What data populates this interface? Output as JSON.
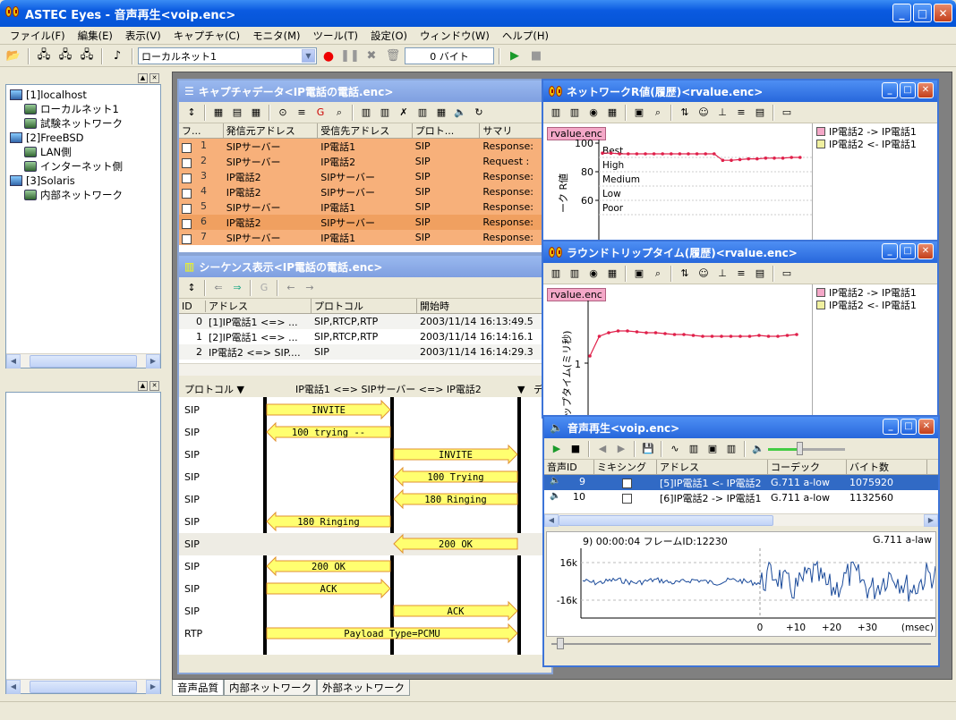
{
  "title": "ASTEC Eyes - 音声再生<voip.enc>",
  "menu": [
    "ファイル(F)",
    "編集(E)",
    "表示(V)",
    "キャプチャ(C)",
    "モニタ(M)",
    "ツール(T)",
    "設定(O)",
    "ウィンドウ(W)",
    "ヘルプ(H)"
  ],
  "toolbar": {
    "network_select": "ローカルネット1",
    "bytes": "0 バイト"
  },
  "tree": [
    {
      "label": "[1]localhost",
      "level": 0,
      "icon": "computer-icon"
    },
    {
      "label": "ローカルネット1",
      "level": 1,
      "icon": "network-icon"
    },
    {
      "label": "試験ネットワーク",
      "level": 1,
      "icon": "network-icon"
    },
    {
      "label": "[2]FreeBSD",
      "level": 0,
      "icon": "computer-icon"
    },
    {
      "label": "LAN側",
      "level": 1,
      "icon": "network-icon"
    },
    {
      "label": "インターネット側",
      "level": 1,
      "icon": "network-icon"
    },
    {
      "label": "[3]Solaris",
      "level": 0,
      "icon": "computer-icon"
    },
    {
      "label": "内部ネットワーク",
      "level": 1,
      "icon": "network-icon"
    }
  ],
  "capture": {
    "title": "キャプチャデータ<IP電話の電話.enc>",
    "columns": [
      "フ...",
      "発信元アドレス",
      "受信先アドレス",
      "プロト...",
      "サマリ"
    ],
    "rows": [
      [
        "1",
        "SIPサーバー",
        "IP電話1",
        "SIP",
        "Response:"
      ],
      [
        "2",
        "SIPサーバー",
        "IP電話2",
        "SIP",
        "Request :"
      ],
      [
        "3",
        "IP電話2",
        "SIPサーバー",
        "SIP",
        "Response:"
      ],
      [
        "4",
        "IP電話2",
        "SIPサーバー",
        "SIP",
        "Response:"
      ],
      [
        "5",
        "SIPサーバー",
        "IP電話1",
        "SIP",
        "Response:"
      ],
      [
        "6",
        "IP電話2",
        "SIPサーバー",
        "SIP",
        "Response:"
      ],
      [
        "7",
        "SIPサーバー",
        "IP電話1",
        "SIP",
        "Response:"
      ]
    ],
    "selected_row": 5
  },
  "sequence": {
    "title": "シーケンス表示<IP電話の電話.enc>",
    "columns": [
      "ID",
      "アドレス",
      "プロトコル",
      "開始時"
    ],
    "rows": [
      [
        "0",
        "[1]IP電話1 <=> ...",
        "SIP,RTCP,RTP",
        "2003/11/14  16:13:49.5"
      ],
      [
        "1",
        "[2]IP電話1 <=> ...",
        "SIP,RTCP,RTP",
        "2003/11/14  16:14:16.1"
      ],
      [
        "2",
        "IP電話2 <=> SIP....",
        "SIP",
        "2003/11/14  16:14:29.3"
      ]
    ],
    "diagram_header": {
      "protocol": "プロトコル",
      "path": "IP電話1 <=> SIPサーバー <=> IP電話2",
      "extra": "デ"
    },
    "messages": [
      {
        "proto": "SIP",
        "label": "INVITE",
        "from": 0,
        "to": 1
      },
      {
        "proto": "SIP",
        "label": "100 trying --",
        "from": 1,
        "to": 0
      },
      {
        "proto": "SIP",
        "label": "INVITE",
        "from": 1,
        "to": 2
      },
      {
        "proto": "SIP",
        "label": "100 Trying",
        "from": 2,
        "to": 1
      },
      {
        "proto": "SIP",
        "label": "180 Ringing",
        "from": 2,
        "to": 1
      },
      {
        "proto": "SIP",
        "label": "180 Ringing",
        "from": 1,
        "to": 0
      },
      {
        "proto": "SIP",
        "label": "200 OK",
        "from": 2,
        "to": 1
      },
      {
        "proto": "SIP",
        "label": "200 OK",
        "from": 1,
        "to": 0
      },
      {
        "proto": "SIP",
        "label": "ACK",
        "from": 0,
        "to": 1
      },
      {
        "proto": "SIP",
        "label": "ACK",
        "from": 1,
        "to": 2
      },
      {
        "proto": "RTP",
        "label": "Payload Type=PCMU",
        "from": 0,
        "to": 2
      }
    ]
  },
  "rvalue": {
    "title": "ネットワークR値(履歴)<rvalue.enc>",
    "tag": "rvalue.enc",
    "ylabel": "ーク R値",
    "yticks": [
      "100",
      "80",
      "60"
    ],
    "bands": [
      "Best",
      "High",
      "Medium",
      "Low",
      "Poor"
    ],
    "legend": [
      "IP電話2 -> IP電話1",
      "IP電話2 <- IP電話1"
    ],
    "legend_colors": [
      "#f4a8c8",
      "#f0f0a0"
    ]
  },
  "rtt": {
    "title": "ラウンドトリップタイム(履歴)<rvalue.enc>",
    "tag": "rvalue.enc",
    "ylabel": "ップタイム(ミリ秒)",
    "ytick": "1",
    "legend": [
      "IP電話2 -> IP電話1",
      "IP電話2 <- IP電話1"
    ]
  },
  "audio": {
    "title": "音声再生<voip.enc>",
    "columns": [
      "音声ID",
      "ミキシング",
      "アドレス",
      "コーデック",
      "バイト数"
    ],
    "rows": [
      [
        "9",
        "",
        "[5]IP電話1 <- IP電話2",
        "G.711 a-low",
        "1075920"
      ],
      [
        "10",
        "",
        "[6]IP電話2 -> IP電話1",
        "G.711 a-low",
        "1132560"
      ]
    ],
    "wave_info": "9) 00:00:04 フレームID:12230",
    "codec": "G.711 a-law",
    "yticks": [
      "16k",
      "-16k"
    ],
    "xticks": [
      "0",
      "+10",
      "+20",
      "+30"
    ],
    "xunit": "(msec)"
  },
  "tabs": [
    "音声品質",
    "内部ネットワーク",
    "外部ネットワーク"
  ],
  "accent": "#0a5ae0"
}
